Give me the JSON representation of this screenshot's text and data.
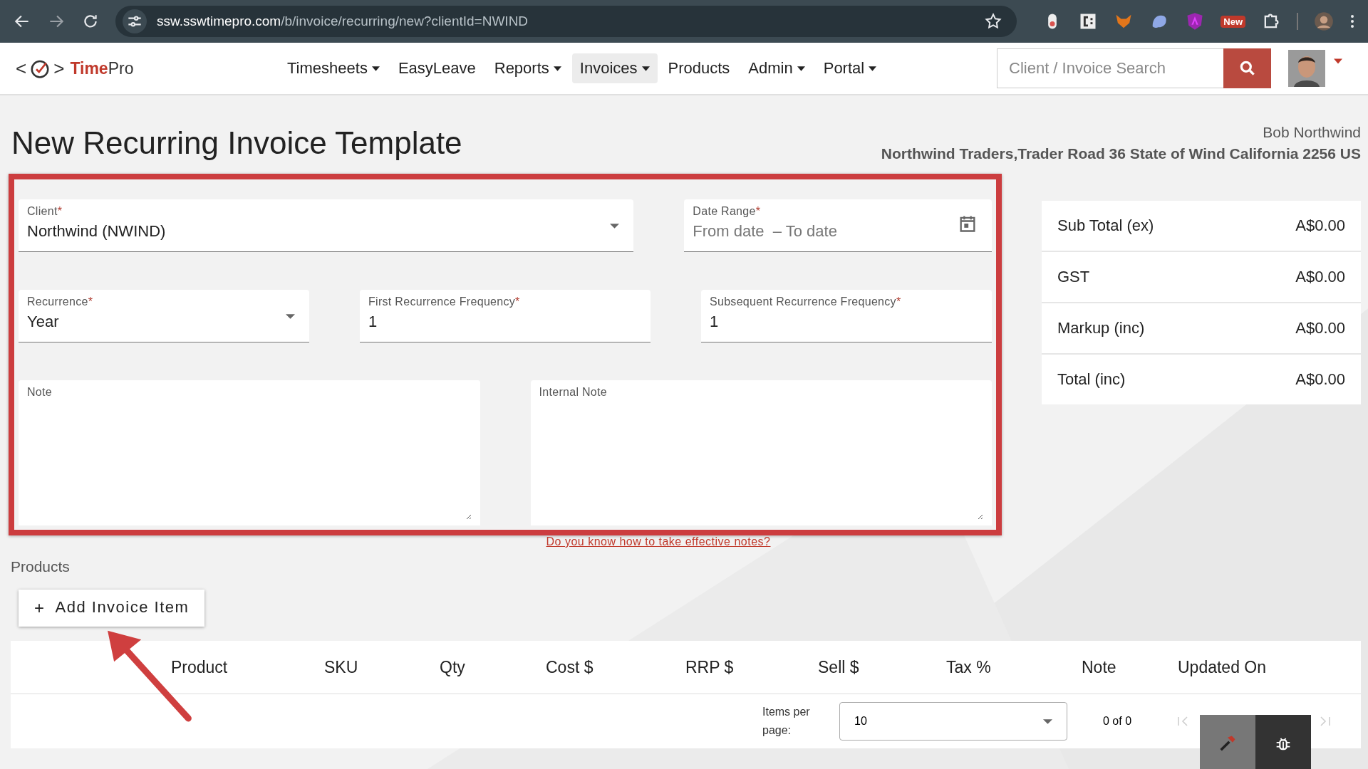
{
  "browser": {
    "url_host": "ssw.sswtimepro.com",
    "url_path": "/b/invoice/recurring/new?clientId=NWIND",
    "extension_badge": "New"
  },
  "nav": {
    "logo_left": "<",
    "logo_right": ">",
    "brand_accent": "Time",
    "brand_rest": "Pro",
    "items": [
      {
        "label": "Timesheets",
        "dropdown": true,
        "selected": false
      },
      {
        "label": "EasyLeave",
        "dropdown": false,
        "selected": false
      },
      {
        "label": "Reports",
        "dropdown": true,
        "selected": false
      },
      {
        "label": "Invoices",
        "dropdown": true,
        "selected": true
      },
      {
        "label": "Products",
        "dropdown": false,
        "selected": false
      },
      {
        "label": "Admin",
        "dropdown": true,
        "selected": false
      },
      {
        "label": "Portal",
        "dropdown": true,
        "selected": false
      }
    ],
    "search": {
      "placeholder": "Client / Invoice Search"
    }
  },
  "page": {
    "title": "New Recurring Invoice Template",
    "contact_name": "Bob Northwind",
    "contact_address": "Northwind Traders,Trader Road 36 State of Wind California 2256 US"
  },
  "form": {
    "client": {
      "kind": "select",
      "label": "Client",
      "required_mark": "*",
      "value": "Northwind (NWIND)"
    },
    "date_range": {
      "kind": "daterange",
      "label": "Date Range",
      "required_mark": "*",
      "from_placeholder": "From date",
      "separator": "–",
      "to_placeholder": "To date"
    },
    "recurrence": {
      "kind": "select",
      "label": "Recurrence",
      "required_mark": "*",
      "value": "Year"
    },
    "first_frequency": {
      "kind": "text",
      "label": "First Recurrence Frequency",
      "required_mark": "*",
      "value": "1"
    },
    "subsequent_frequency": {
      "kind": "text",
      "label": "Subsequent Recurrence Frequency",
      "required_mark": "*",
      "value": "1"
    },
    "note": {
      "kind": "textarea",
      "label": "Note"
    },
    "internal_note": {
      "kind": "textarea",
      "label": "Internal Note"
    },
    "help_link": "Do you know how to take effective notes?"
  },
  "totals": [
    {
      "label": "Sub Total (ex)",
      "value": "A$0.00"
    },
    {
      "label": "GST",
      "value": "A$0.00"
    },
    {
      "label": "Markup (inc)",
      "value": "A$0.00"
    },
    {
      "label": "Total (inc)",
      "value": "A$0.00"
    }
  ],
  "products": {
    "heading": "Products",
    "add_button": {
      "icon": "+",
      "label": "Add Invoice Item"
    },
    "columns": [
      "Product",
      "SKU",
      "Qty",
      "Cost $",
      "RRP $",
      "Sell $",
      "Tax %",
      "Note",
      "Updated On"
    ],
    "paginator": {
      "items_per_page": "Items per page:",
      "page_size": "10",
      "range": "0 of 0",
      "first_disabled": true,
      "last_disabled": true
    }
  }
}
